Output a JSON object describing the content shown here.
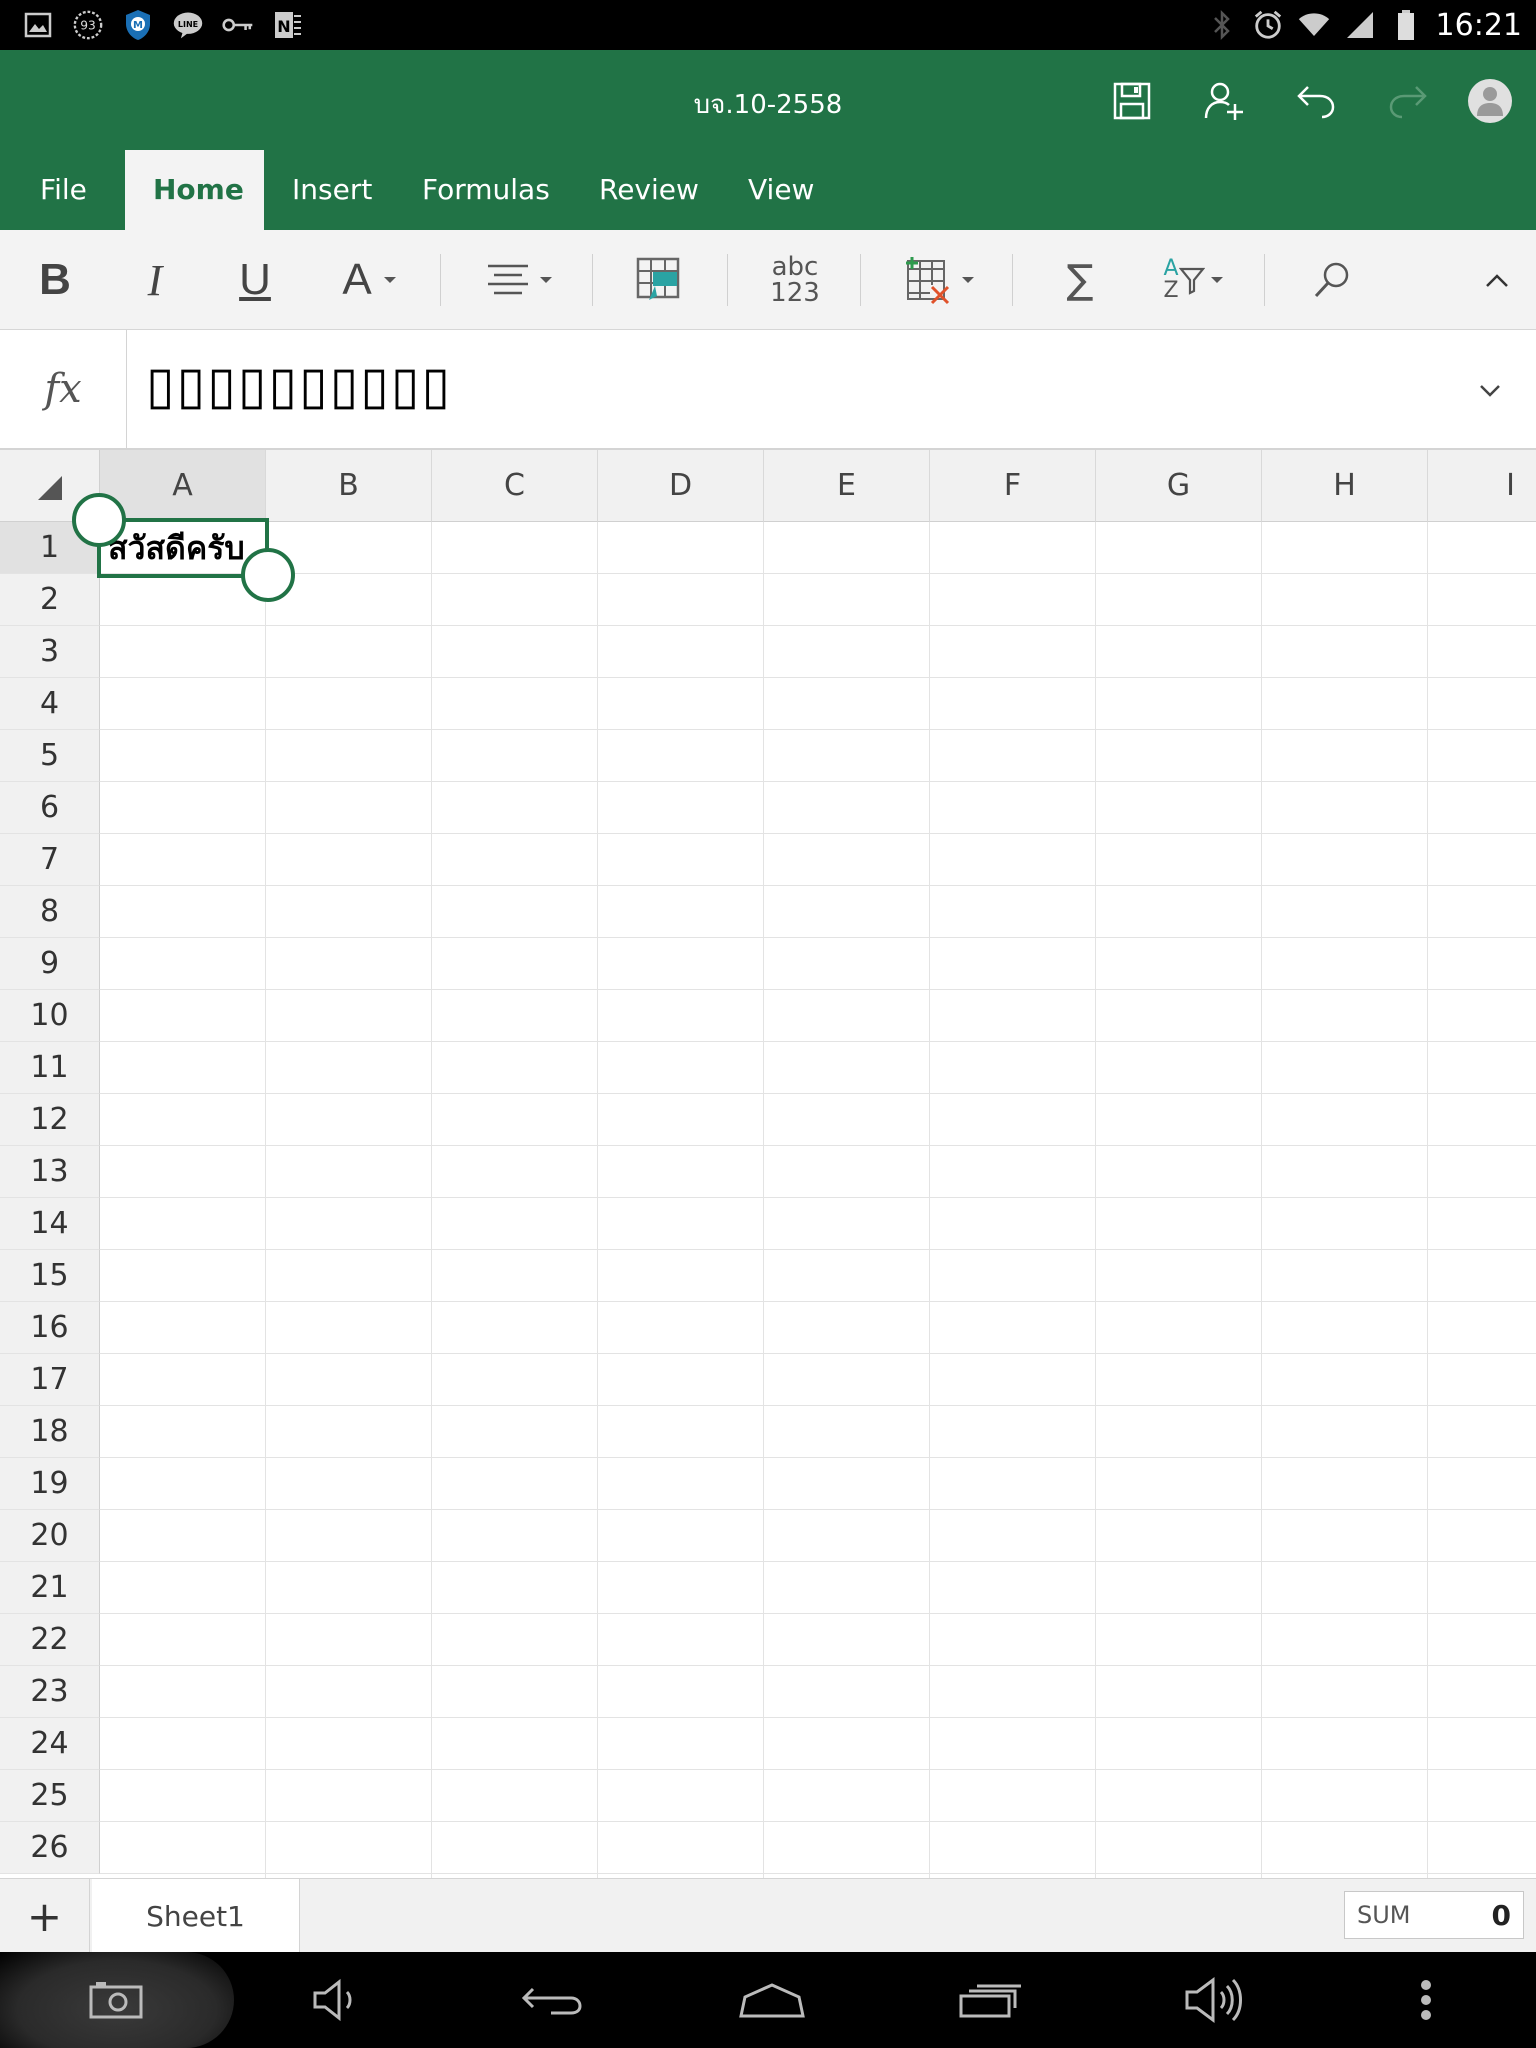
{
  "status_bar": {
    "time": "16:21",
    "badge_count": "93",
    "line_label": "LINE",
    "notification_icons": [
      "image-icon",
      "count-badge-icon",
      "shield-icon",
      "line-icon",
      "key-icon",
      "onenote-icon"
    ],
    "system_icons": [
      "bluetooth-icon",
      "alarm-icon",
      "wifi-icon",
      "signal-icon",
      "battery-icon"
    ]
  },
  "title_bar": {
    "document_title": "บจ.10-2558",
    "buttons": [
      "save-icon",
      "share-icon",
      "undo-icon",
      "redo-icon",
      "account-avatar-icon"
    ]
  },
  "tabs": [
    {
      "label": "File",
      "active": false
    },
    {
      "label": "Home",
      "active": true
    },
    {
      "label": "Insert",
      "active": false
    },
    {
      "label": "Formulas",
      "active": false
    },
    {
      "label": "Review",
      "active": false
    },
    {
      "label": "View",
      "active": false
    }
  ],
  "ribbon": {
    "bold": "B",
    "italic": "I",
    "underline": "U",
    "font_color": "A",
    "number_format_top": "abc",
    "number_format_bottom": "123",
    "autosum": "∑",
    "sort_a": "A",
    "sort_z": "Z"
  },
  "formula_bar": {
    "fx_label": "fx",
    "content": "▯▯▯▯▯▯▯▯▯▯"
  },
  "grid": {
    "columns": [
      "A",
      "B",
      "C",
      "D",
      "E",
      "F",
      "G",
      "H",
      "I"
    ],
    "rows": [
      "1",
      "2",
      "3",
      "4",
      "5",
      "6",
      "7",
      "8",
      "9",
      "10",
      "11",
      "12",
      "13",
      "14",
      "15",
      "16",
      "17",
      "18",
      "19",
      "20",
      "21",
      "22",
      "23",
      "24",
      "25",
      "26"
    ],
    "selected_cell": "A1",
    "cells": {
      "A1": "สวัสดีครับ"
    }
  },
  "sheet_bar": {
    "add_label": "+",
    "sheet_name": "Sheet1",
    "sum_label": "SUM",
    "sum_value": "0"
  },
  "nav_bar": {
    "buttons": [
      "screenshot-icon",
      "volume-down-icon",
      "back-icon",
      "home-icon",
      "recent-apps-icon",
      "volume-up-icon",
      "more-icon"
    ]
  },
  "colors": {
    "accent": "#217346",
    "ribbon_bg": "#f3f3f3",
    "header_bg": "#f1f1f1"
  }
}
